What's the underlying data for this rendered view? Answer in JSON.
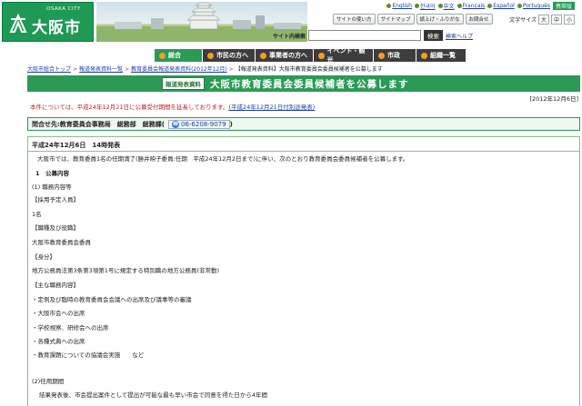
{
  "header": {
    "logo_sub": "OSAKA CITY",
    "logo_name": "大阪市"
  },
  "languages": [
    "English",
    "한국어",
    "中文",
    "Français",
    "Español",
    "Português"
  ],
  "mobile_label": "携帯版",
  "toolbar": [
    "サイトの使い方",
    "サイトマップ",
    "読上げ・ふりがな",
    "お問合せ"
  ],
  "text_size": {
    "label": "文字サイズ",
    "sizes": [
      "大",
      "中",
      "小"
    ]
  },
  "search": {
    "label": "サイト内検索",
    "button": "検索",
    "help": "検索ヘルプ",
    "value": ""
  },
  "gnav": [
    {
      "label": "総合"
    },
    {
      "label": "市民の方へ"
    },
    {
      "label": "事業者の方へ"
    },
    {
      "label": "イベント・観光"
    },
    {
      "label": "市政"
    },
    {
      "label": "組織一覧"
    }
  ],
  "breadcrumb": [
    "大阪市総合トップ",
    "報道発表資料一覧",
    "教育委員会報道発表資料(2012年12月)",
    "【報道発表資料】大阪市教育委員会委員候補者を公募します"
  ],
  "page": {
    "tag": "報道発表資料",
    "title": "大阪市教育委員会委員候補者を公募します",
    "date": "[2012年12月6日]",
    "notice_text": "本件については、平成24年12月21日に公募受付期間を延長しております。",
    "notice_link": "(平成24年12月21日付別途発表)"
  },
  "contact": {
    "label": "問合せ先:教育委員会事務局　総務部　総務課(",
    "phone": "06-6208-9079",
    "close": ")"
  },
  "body": {
    "heading": "平成24年12月6日　14時発表",
    "lines": [
      "大阪市では、教育委員1名の任期満了(勝井映子委員:任期　平成24年12月2日まで)に伴い、次のとおり教育委員会委員候補者を公募します。",
      "1　公募内容",
      "(1) 職務内容等",
      "【採用予定人員】",
      "1名",
      "【職種及び役職】",
      "大阪市教育委員会委員",
      "【身分】",
      "地方公務員法第3条第3項第1号に規定する特別職の地方公務員(非常勤)",
      "【主な職務内容】",
      "・定例及び臨時の教育委員会会議への出席及び議事等の審議",
      "・大阪市会への出席",
      "・学校視察、研修会への出席",
      "・各種式典への出席",
      "・教育課題についての協議会実施　　など",
      "(2)任用期間",
      "結果発表後、市会提出案件として提出が可能な最も早い市会で同意を得た日から4年間"
    ]
  },
  "colors": {
    "brand_green": "#2b9a56",
    "nav_dark": "#3d3d3d",
    "notice_red": "#c32020",
    "link_blue": "#1a3fa0"
  }
}
